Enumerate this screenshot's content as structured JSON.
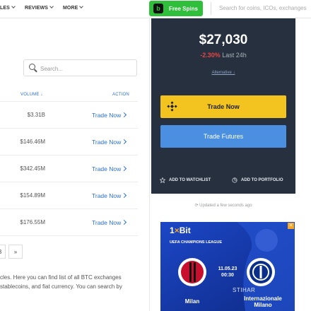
{
  "nav": {
    "items": [
      "LES",
      "REVIEWS",
      "MORE"
    ],
    "spin_button": "Free Spins",
    "search_placeholder": "Search for coins, ICOs, exchanges"
  },
  "exchange_list": {
    "search_placeholder": "Search...",
    "columns": [
      "VOLUME",
      "ACTION"
    ],
    "rows": [
      {
        "volume": "$3.31B",
        "action": "Trade Now"
      },
      {
        "volume": "$146.46M",
        "action": "Trade Now"
      },
      {
        "volume": "$342.45M",
        "action": "Trade Now"
      },
      {
        "volume": "$154.89M",
        "action": "Trade Now"
      },
      {
        "volume": "$176.55M",
        "action": "Trade Now"
      }
    ],
    "pagination": [
      "3",
      "»"
    ],
    "description": [
      "cles. Here you can find list of all BTC exchanges",
      " stablecoins, and fiat currency. You can search by"
    ]
  },
  "price_card": {
    "price": "$27,030",
    "change": "-2.30%",
    "period": "Last 24h",
    "alternative_link": "Alternative ↓",
    "trade_now": "Trade Now",
    "trade_futures": "Trade Futures",
    "add_watchlist": "ADD TO WATCHLIST",
    "add_portfolio": "ADD TO PORTFOLIO"
  },
  "updated_text": "Updated a few seconds ago",
  "ad": {
    "brand_one": "1",
    "brand_x": "×",
    "brand_bit": "Bit",
    "league": "UEFA CHAMPIONS LEAGUE",
    "date": "11.05.23",
    "time": "00:30",
    "team_home": "Milan",
    "team_away_1": "Internazionale",
    "team_away_2": "Milano",
    "watermark": "STIHAR"
  },
  "colors": {
    "accent_blue": "#2a6fd6",
    "card_bg": "#27303e",
    "trade_yellow": "#f3c41f",
    "futures_blue": "#4a8fe0",
    "negative": "#e84545",
    "spin_green": "#2fbf3b"
  }
}
